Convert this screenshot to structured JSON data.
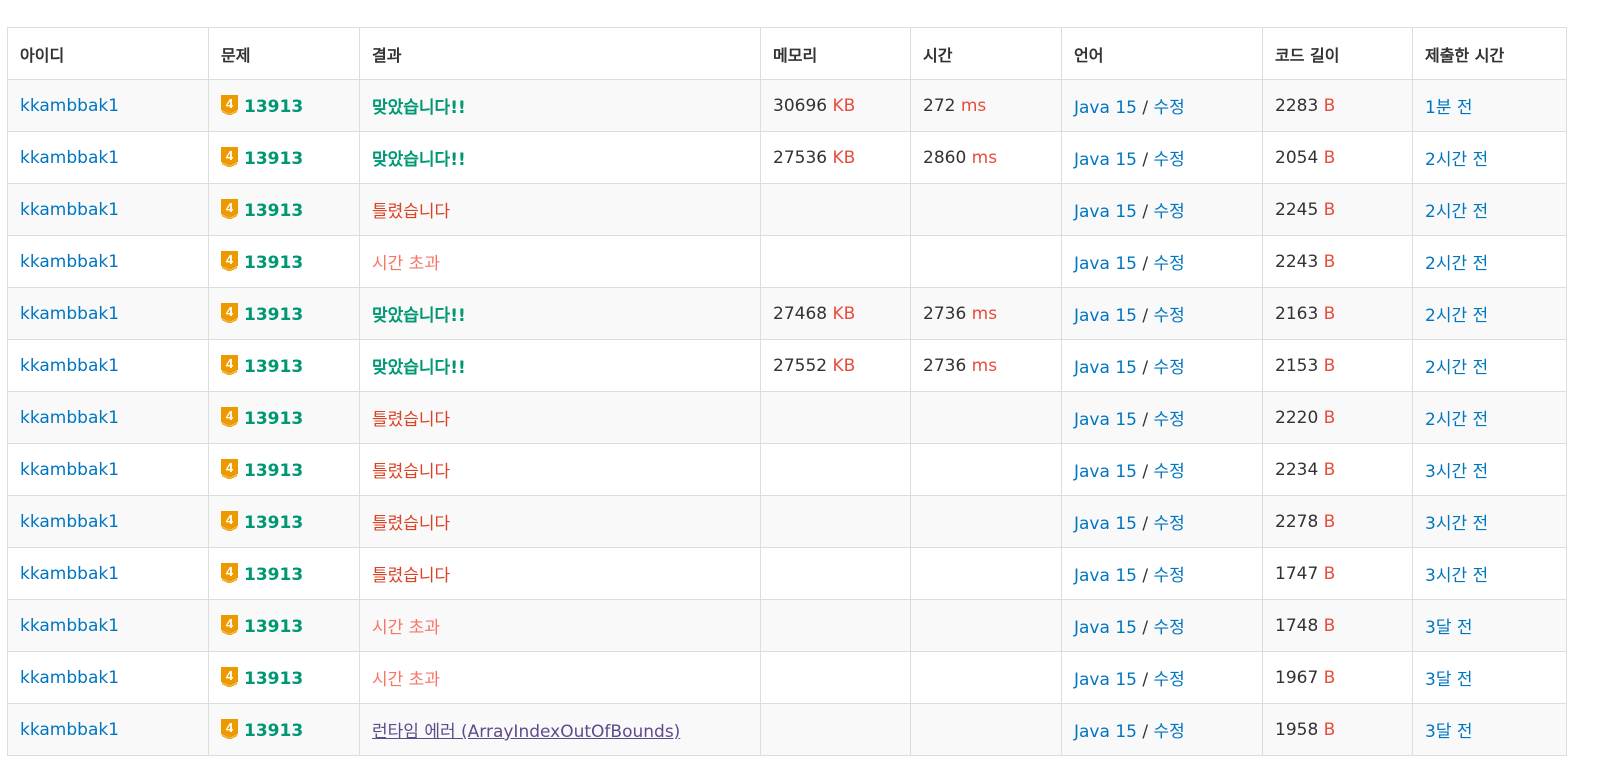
{
  "colors": {
    "accepted": "#009874",
    "wrong": "#dd4124",
    "timeout": "#fa7268",
    "runtime": "#5f4b8b",
    "link": "#0076c0",
    "unit": "#e74c3c",
    "tier": "#ec9a00"
  },
  "headers": [
    "아이디",
    "문제",
    "결과",
    "메모리",
    "시간",
    "언어",
    "코드 길이",
    "제출한 시간"
  ],
  "rows": [
    {
      "user": "kkambbak1",
      "tier": "4",
      "problem": "13913",
      "result": "맞았습니다!!",
      "status": "ac",
      "memory": "30696",
      "mem_unit": "KB",
      "time": "272",
      "time_unit": "ms",
      "lang": "Java 15",
      "sep": " / ",
      "edit": "수정",
      "len": "2283",
      "len_unit": "B",
      "submitted": "1분 전"
    },
    {
      "user": "kkambbak1",
      "tier": "4",
      "problem": "13913",
      "result": "맞았습니다!!",
      "status": "ac",
      "memory": "27536",
      "mem_unit": "KB",
      "time": "2860",
      "time_unit": "ms",
      "lang": "Java 15",
      "sep": " / ",
      "edit": "수정",
      "len": "2054",
      "len_unit": "B",
      "submitted": "2시간 전"
    },
    {
      "user": "kkambbak1",
      "tier": "4",
      "problem": "13913",
      "result": "틀렸습니다",
      "status": "wa",
      "lang": "Java 15",
      "sep": " / ",
      "edit": "수정",
      "len": "2245",
      "len_unit": "B",
      "submitted": "2시간 전"
    },
    {
      "user": "kkambbak1",
      "tier": "4",
      "problem": "13913",
      "result": "시간 초과",
      "status": "tle",
      "lang": "Java 15",
      "sep": " / ",
      "edit": "수정",
      "len": "2243",
      "len_unit": "B",
      "submitted": "2시간 전"
    },
    {
      "user": "kkambbak1",
      "tier": "4",
      "problem": "13913",
      "result": "맞았습니다!!",
      "status": "ac",
      "memory": "27468",
      "mem_unit": "KB",
      "time": "2736",
      "time_unit": "ms",
      "lang": "Java 15",
      "sep": " / ",
      "edit": "수정",
      "len": "2163",
      "len_unit": "B",
      "submitted": "2시간 전"
    },
    {
      "user": "kkambbak1",
      "tier": "4",
      "problem": "13913",
      "result": "맞았습니다!!",
      "status": "ac",
      "memory": "27552",
      "mem_unit": "KB",
      "time": "2736",
      "time_unit": "ms",
      "lang": "Java 15",
      "sep": " / ",
      "edit": "수정",
      "len": "2153",
      "len_unit": "B",
      "submitted": "2시간 전"
    },
    {
      "user": "kkambbak1",
      "tier": "4",
      "problem": "13913",
      "result": "틀렸습니다",
      "status": "wa",
      "lang": "Java 15",
      "sep": " / ",
      "edit": "수정",
      "len": "2220",
      "len_unit": "B",
      "submitted": "2시간 전"
    },
    {
      "user": "kkambbak1",
      "tier": "4",
      "problem": "13913",
      "result": "틀렸습니다",
      "status": "wa",
      "lang": "Java 15",
      "sep": " / ",
      "edit": "수정",
      "len": "2234",
      "len_unit": "B",
      "submitted": "3시간 전"
    },
    {
      "user": "kkambbak1",
      "tier": "4",
      "problem": "13913",
      "result": "틀렸습니다",
      "status": "wa",
      "lang": "Java 15",
      "sep": " / ",
      "edit": "수정",
      "len": "2278",
      "len_unit": "B",
      "submitted": "3시간 전"
    },
    {
      "user": "kkambbak1",
      "tier": "4",
      "problem": "13913",
      "result": "틀렸습니다",
      "status": "wa",
      "lang": "Java 15",
      "sep": " / ",
      "edit": "수정",
      "len": "1747",
      "len_unit": "B",
      "submitted": "3시간 전"
    },
    {
      "user": "kkambbak1",
      "tier": "4",
      "problem": "13913",
      "result": "시간 초과",
      "status": "tle",
      "lang": "Java 15",
      "sep": " / ",
      "edit": "수정",
      "len": "1748",
      "len_unit": "B",
      "submitted": "3달 전"
    },
    {
      "user": "kkambbak1",
      "tier": "4",
      "problem": "13913",
      "result": "시간 초과",
      "status": "tle",
      "lang": "Java 15",
      "sep": " / ",
      "edit": "수정",
      "len": "1967",
      "len_unit": "B",
      "submitted": "3달 전"
    },
    {
      "user": "kkambbak1",
      "tier": "4",
      "problem": "13913",
      "result": "런타임 에러 (ArrayIndexOutOfBounds)",
      "status": "rte",
      "lang": "Java 15",
      "sep": " / ",
      "edit": "수정",
      "len": "1958",
      "len_unit": "B",
      "submitted": "3달 전"
    }
  ]
}
